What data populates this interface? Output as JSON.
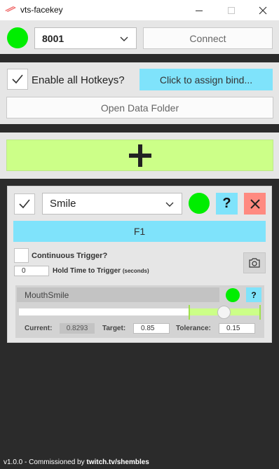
{
  "window": {
    "title": "vts-facekey",
    "minimize_icon": "minimize-icon",
    "maximize_icon": "maximize-icon",
    "close_icon": "close-icon"
  },
  "connection": {
    "status_color": "#00e600",
    "port": "8001",
    "connect_label": "Connect"
  },
  "hotkeys": {
    "enabled": true,
    "enable_label": "Enable all Hotkeys?",
    "assign_label": "Click to assign bind...",
    "open_folder_label": "Open Data Folder"
  },
  "add_button": {
    "icon": "plus-icon",
    "color": "#ccff88"
  },
  "card": {
    "enabled": true,
    "expression": "Smile",
    "status_color": "#00ee00",
    "help_label": "?",
    "delete_icon": "close-icon",
    "hotkey": "F1",
    "continuous_checked": false,
    "continuous_label": "Continuous Trigger?",
    "hold_time_value": "0",
    "hold_time_label": "Hold Time to Trigger",
    "hold_time_unit": "(seconds)",
    "camera_icon": "camera-icon",
    "param": {
      "name": "MouthSmile",
      "help_label": "?",
      "slider_value": 0.85,
      "tolerance_fraction": 0.15,
      "current_label": "Current:",
      "current_value": "0.8293",
      "target_label": "Target:",
      "target_value": "0.85",
      "tolerance_label": "Tolerance:",
      "tolerance_value": "0.15"
    }
  },
  "footer": {
    "version_text": "v1.0.0 - Commissioned by ",
    "link_text": "twitch.tv/shembles"
  },
  "colors": {
    "accent_blue": "#7fe3fb",
    "accent_green": "#ccff88",
    "delete_red": "#ff8a80",
    "background": "#2b2b2b",
    "panel": "#e6e6e6"
  }
}
